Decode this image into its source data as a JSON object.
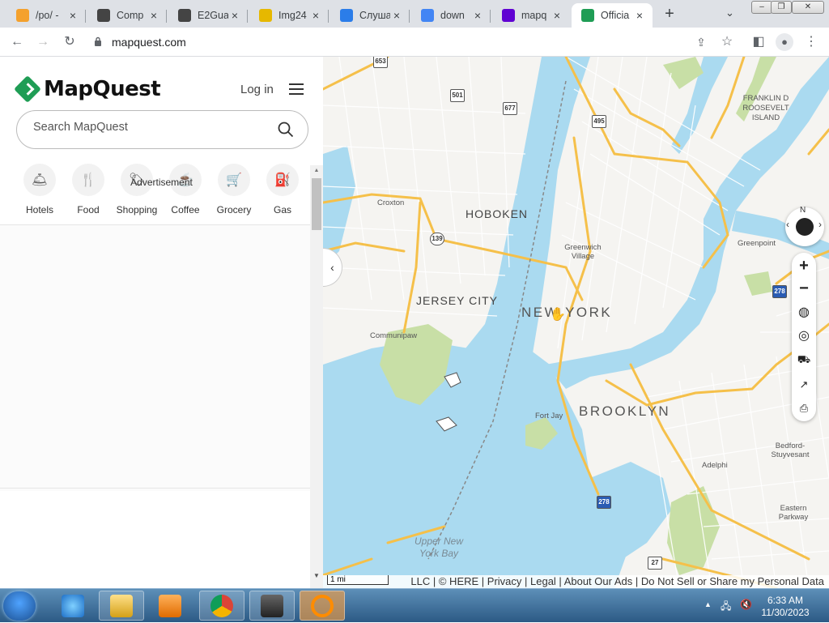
{
  "browser": {
    "tabs": [
      {
        "title": "/po/ -",
        "icon": "bolt-icon",
        "color": "#f4a12d"
      },
      {
        "title": "Comp",
        "icon": "puzzle-icon",
        "color": "#444444"
      },
      {
        "title": "E2Gua",
        "icon": "puzzle-icon",
        "color": "#444444"
      },
      {
        "title": "Img24",
        "icon": "flower-icon",
        "color": "#e6b800"
      },
      {
        "title": "Слуша",
        "icon": "refresh-c-icon",
        "color": "#2b7de9"
      },
      {
        "title": "down",
        "icon": "google-g-icon",
        "color": "#4285f4"
      },
      {
        "title": "mapq",
        "icon": "yahoo-icon",
        "color": "#6001d2"
      },
      {
        "title": "Officia",
        "icon": "mapquest-icon",
        "color": "#1f9d55",
        "active": true
      }
    ],
    "url": "mapquest.com"
  },
  "sidebar": {
    "logo_text": "MapQuest",
    "login_label": "Log in",
    "search_placeholder": "Search MapQuest",
    "categories": [
      {
        "label": "Hotels",
        "icon": "bell-icon"
      },
      {
        "label": "Food",
        "icon": "utensils-icon"
      },
      {
        "label": "Shopping",
        "icon": "tag-icon"
      },
      {
        "label": "Coffee",
        "icon": "coffee-icon"
      },
      {
        "label": "Grocery",
        "icon": "cart-icon"
      },
      {
        "label": "Gas",
        "icon": "fuel-icon"
      }
    ],
    "ad_label": "Advertisement"
  },
  "map": {
    "labels": {
      "hoboken": "HOBOKEN",
      "jersey_city": "JERSEY CITY",
      "new_york": "NEW YORK",
      "brooklyn": "BROOKLYN",
      "croxton": "Croxton",
      "greenwich": "Greenwich Village",
      "communipaw": "Communipaw",
      "fort_jay": "Fort Jay",
      "greenpoint": "Greenpoint",
      "roosevelt": "FRANKLIN D ROOSEVELT ISLAND",
      "bedford": "Bedford-Stuyvesant",
      "adelphi": "Adelphi",
      "eastern_parkway": "Eastern Parkway",
      "upper_bay": "Upper New York Bay"
    },
    "shields": [
      "653",
      "501",
      "677",
      "495",
      "139",
      "278",
      "278",
      "27"
    ],
    "compass_label": "N",
    "scale_label": "1 mi",
    "attribution": "LLC | © HERE | Privacy | Legal | About Our Ads | Do Not Sell or Share my Personal Data",
    "colors": {
      "water": "#aadaf0",
      "park": "#c8dfa6",
      "highway": "#f5c04a",
      "land": "#f5f4f1"
    }
  },
  "taskbar": {
    "time": "6:33 AM",
    "date": "11/30/2023"
  }
}
